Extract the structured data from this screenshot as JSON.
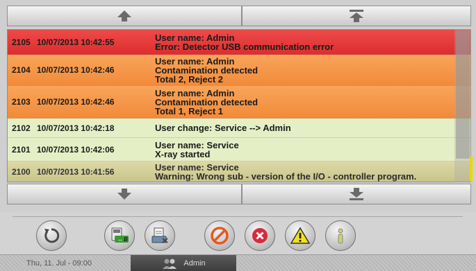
{
  "navigation": {
    "scroll_up": "arrow-up-icon",
    "scroll_top": "arrow-to-top-icon",
    "scroll_down": "arrow-down-icon",
    "scroll_bottom": "arrow-to-bottom-icon"
  },
  "log": {
    "entries": [
      {
        "id": "2105",
        "timestamp": "10/07/2013 10:42:55",
        "lines": [
          "User name: Admin",
          "Error: Detector USB communication error"
        ],
        "severity": "error"
      },
      {
        "id": "2104",
        "timestamp": "10/07/2013 10:42:46",
        "lines": [
          "User name: Admin",
          "Contamination detected",
          "Total 2, Reject 2"
        ],
        "severity": "warning"
      },
      {
        "id": "2103",
        "timestamp": "10/07/2013 10:42:46",
        "lines": [
          "User name: Admin",
          "Contamination detected",
          "Total 1, Reject 1"
        ],
        "severity": "warning"
      },
      {
        "id": "2102",
        "timestamp": "10/07/2013 10:42:18",
        "lines": [
          "User change: Service --> Admin"
        ],
        "severity": "info"
      },
      {
        "id": "2101",
        "timestamp": "10/07/2013 10:42:06",
        "lines": [
          "User name: Service",
          "X-ray started"
        ],
        "severity": "info"
      },
      {
        "id": "2100",
        "timestamp": "10/07/2013 10:41:56",
        "lines": [
          "User name: Service",
          "Warning: Wrong sub - version of the I/O - controller program."
        ],
        "severity": "selected"
      }
    ]
  },
  "toolbar": {
    "buttons": [
      "refresh-icon",
      "export-usb-icon",
      "print-icon",
      "prohibited-filter-icon",
      "error-filter-icon",
      "warning-filter-icon",
      "info-filter-icon"
    ]
  },
  "colors": {
    "error": "#dc2e2e",
    "warning": "#f28a3a",
    "info": "#e5efc6",
    "selected": "#c9c48a"
  },
  "status": {
    "datetime": "Thu, 11. Jul - 09:00",
    "user": "Admin"
  }
}
